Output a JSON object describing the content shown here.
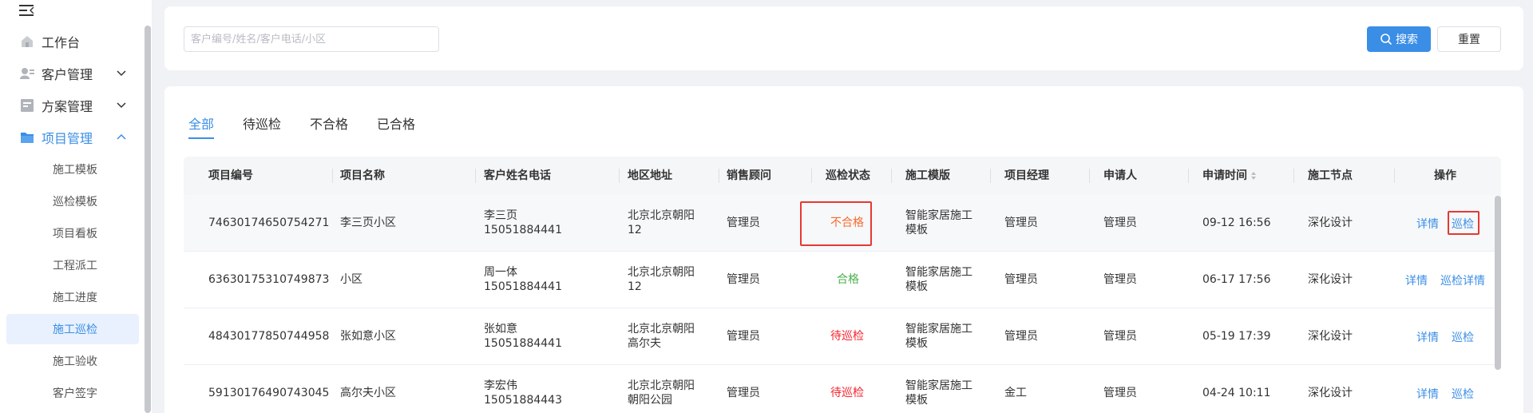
{
  "sidebar": {
    "items": [
      {
        "label": "工作台",
        "icon": "home-icon"
      },
      {
        "label": "客户管理",
        "icon": "user-card-icon"
      },
      {
        "label": "方案管理",
        "icon": "document-icon"
      },
      {
        "label": "项目管理",
        "icon": "folder-icon"
      }
    ],
    "sub_items": [
      {
        "label": "施工模板"
      },
      {
        "label": "巡检模板"
      },
      {
        "label": "项目看板"
      },
      {
        "label": "工程派工"
      },
      {
        "label": "施工进度"
      },
      {
        "label": "施工巡检"
      },
      {
        "label": "施工验收"
      },
      {
        "label": "客户签字"
      }
    ]
  },
  "search": {
    "placeholder": "客户编号/姓名/客户电话/小区",
    "search_label": "搜索",
    "reset_label": "重置"
  },
  "tabs": [
    "全部",
    "待巡检",
    "不合格",
    "已合格"
  ],
  "table": {
    "headers": [
      "项目编号",
      "项目名称",
      "客户姓名电话",
      "地区地址",
      "销售顾问",
      "巡检状态",
      "施工模版",
      "项目经理",
      "申请人",
      "申请时间",
      "施工节点",
      "操作"
    ],
    "rows": [
      {
        "code": "74630174650754271",
        "name": "李三页小区",
        "customer": "李三页",
        "phone": "15051884441",
        "addr1": "北京北京朝阳",
        "addr2": "12",
        "sales": "管理员",
        "status": "不合格",
        "tpl1": "智能家居施工",
        "tpl2": "模板",
        "pm": "管理员",
        "applicant": "管理员",
        "time": "09-12 16:56",
        "node": "深化设计",
        "op1": "详情",
        "op2": "巡检"
      },
      {
        "code": "63630175310749873",
        "name": "小区",
        "customer": "周一体",
        "phone": "15051884441",
        "addr1": "北京北京朝阳",
        "addr2": "12",
        "sales": "管理员",
        "status": "合格",
        "tpl1": "智能家居施工",
        "tpl2": "模板",
        "pm": "管理员",
        "applicant": "管理员",
        "time": "06-17 17:56",
        "node": "深化设计",
        "op1": "详情",
        "op2": "巡检详情"
      },
      {
        "code": "48430177850744958",
        "name": "张如意小区",
        "customer": "张如意",
        "phone": "15051884441",
        "addr1": "北京北京朝阳",
        "addr2": "高尔夫",
        "sales": "管理员",
        "status": "待巡检",
        "tpl1": "智能家居施工",
        "tpl2": "模板",
        "pm": "管理员",
        "applicant": "管理员",
        "time": "05-19 17:39",
        "node": "深化设计",
        "op1": "详情",
        "op2": "巡检"
      },
      {
        "code": "59130176490743045",
        "name": "高尔夫小区",
        "customer": "李宏伟",
        "phone": "15051884443",
        "addr1": "北京北京朝阳",
        "addr2": "朝阳公园",
        "sales": "管理员",
        "status": "待巡检",
        "tpl1": "智能家居施工",
        "tpl2": "模板",
        "pm": "金工",
        "applicant": "管理员",
        "time": "04-24 10:11",
        "node": "深化设计",
        "op1": "详情",
        "op2": "巡检"
      }
    ]
  },
  "colors": {
    "accent": "#3a8ee6",
    "bad": "#f56c2d",
    "ok": "#4cb050",
    "wait": "#f5222d",
    "highlight_box": "#e53935"
  }
}
